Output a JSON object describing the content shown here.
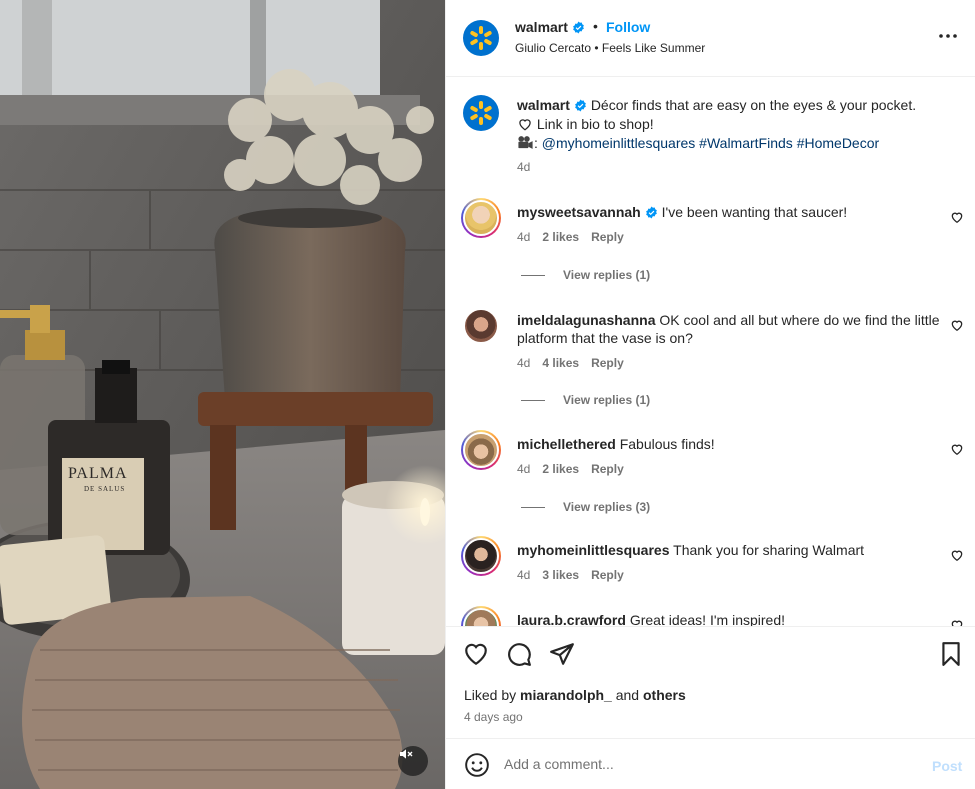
{
  "media": {
    "product_label": "PALMA",
    "product_sublabel": "DE SALUS",
    "mute_icon": "volume-muted-icon"
  },
  "header": {
    "username": "walmart",
    "follow_label": "Follow",
    "separator": "•",
    "subtitle": "Giulio Cercato • Feels Like Summer",
    "more_icon": "more-horizontal-icon"
  },
  "caption": {
    "username": "walmart",
    "text": "Décor finds that are easy on the eyes & your pocket.",
    "line2": "Link in bio to shop!",
    "line3_prefix": ":",
    "mention": "@myhomeinlittlesquares",
    "tag1": "#WalmartFinds",
    "tag2": "#HomeDecor",
    "time": "4d"
  },
  "comments": [
    {
      "username": "mysweetsavannah",
      "verified": true,
      "text": "I've been wanting that saucer!",
      "time": "4d",
      "likes": "2 likes",
      "reply": "Reply",
      "view_replies": "View replies (1)"
    },
    {
      "username": "imeldalagunashanna",
      "verified": false,
      "text": "OK cool and all but where do we find the little platform that the vase is on?",
      "time": "4d",
      "likes": "4 likes",
      "reply": "Reply",
      "view_replies": "View replies (1)"
    },
    {
      "username": "michellethered",
      "verified": false,
      "text": "Fabulous finds!",
      "time": "4d",
      "likes": "2 likes",
      "reply": "Reply",
      "view_replies": "View replies (3)"
    },
    {
      "username": "myhomeinlittlesquares",
      "verified": false,
      "text": "Thank you for sharing Walmart",
      "time": "4d",
      "likes": "3 likes",
      "reply": "Reply"
    },
    {
      "username": "laura.b.crawford",
      "verified": false,
      "text": "Great ideas! I'm inspired!"
    }
  ],
  "actions": {
    "liked_by_prefix": "Liked by",
    "liked_by_user": "miarandolph_",
    "liked_by_and": "and",
    "liked_by_others": "others",
    "post_time": "4 days ago"
  },
  "add_comment": {
    "placeholder": "Add a comment...",
    "post_label": "Post"
  },
  "colors": {
    "accent": "#0095f6",
    "walmart_blue": "#0071ce",
    "walmart_spark": "#ffc220",
    "verified": "#0095f6",
    "muted_text": "#737373",
    "hashtag": "#00376b"
  }
}
